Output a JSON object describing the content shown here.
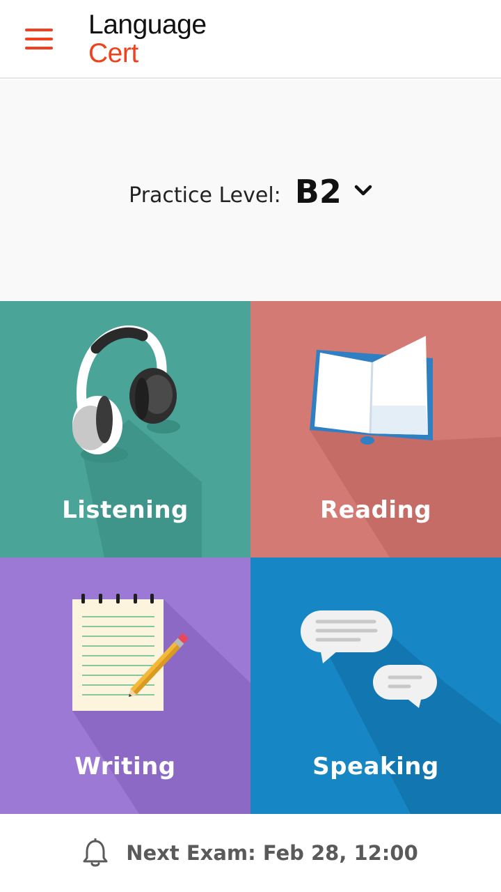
{
  "header": {
    "menu_icon": "hamburger-menu-icon",
    "logo_line1": "Language",
    "logo_line2": "Cert",
    "accent_color": "#f0401d"
  },
  "practice": {
    "label": "Practice Level:",
    "value": "B2",
    "dropdown_icon": "chevron-down-icon"
  },
  "tiles": [
    {
      "label": "Listening",
      "icon": "headphones-icon",
      "color": "#4aa497"
    },
    {
      "label": "Reading",
      "icon": "open-book-icon",
      "color": "#d47a74"
    },
    {
      "label": "Writing",
      "icon": "notepad-pencil-icon",
      "color": "#9d79d6"
    },
    {
      "label": "Speaking",
      "icon": "speech-bubbles-icon",
      "color": "#1686c4"
    }
  ],
  "footer": {
    "icon": "bell-icon",
    "next_exam": "Next Exam: Feb 28, 12:00"
  }
}
